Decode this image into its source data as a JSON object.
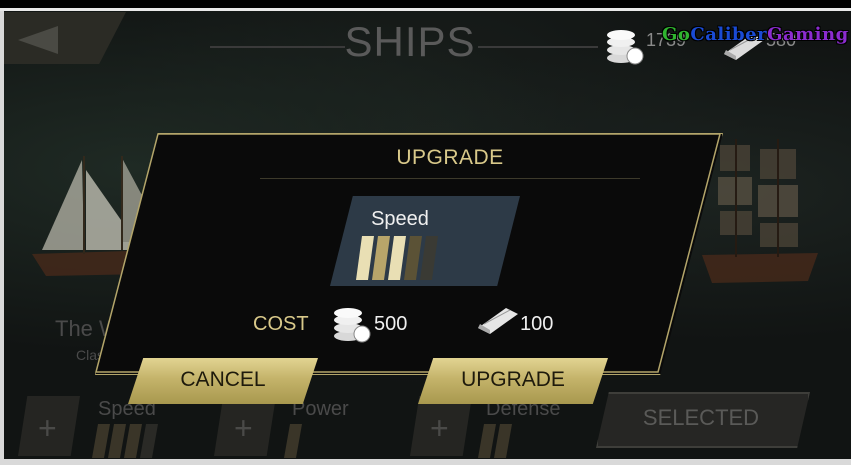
{
  "header": {
    "title": "SHIPS",
    "coins_value": "1739",
    "wood_value": "580"
  },
  "watermark": {
    "part1": "Go",
    "part2": "Caliber",
    "part3": "Gaming"
  },
  "ship": {
    "name": "The Wanderer",
    "class": "Class: SCHOONER"
  },
  "stats": [
    {
      "label": "Speed"
    },
    {
      "label": "Power"
    },
    {
      "label": "Defense"
    }
  ],
  "selected_label": "SELECTED",
  "modal": {
    "title": "UPGRADE",
    "stat_name": "Speed",
    "stat_level": 3,
    "stat_max": 5,
    "cost_label": "COST",
    "cost_coins": "500",
    "cost_wood": "100",
    "cancel_label": "CANCEL",
    "upgrade_label": "UPGRADE"
  },
  "colors": {
    "gold_text": "#d9c98a",
    "button_gold": "#c4b36a",
    "panel_blue": "#2d3a47"
  }
}
